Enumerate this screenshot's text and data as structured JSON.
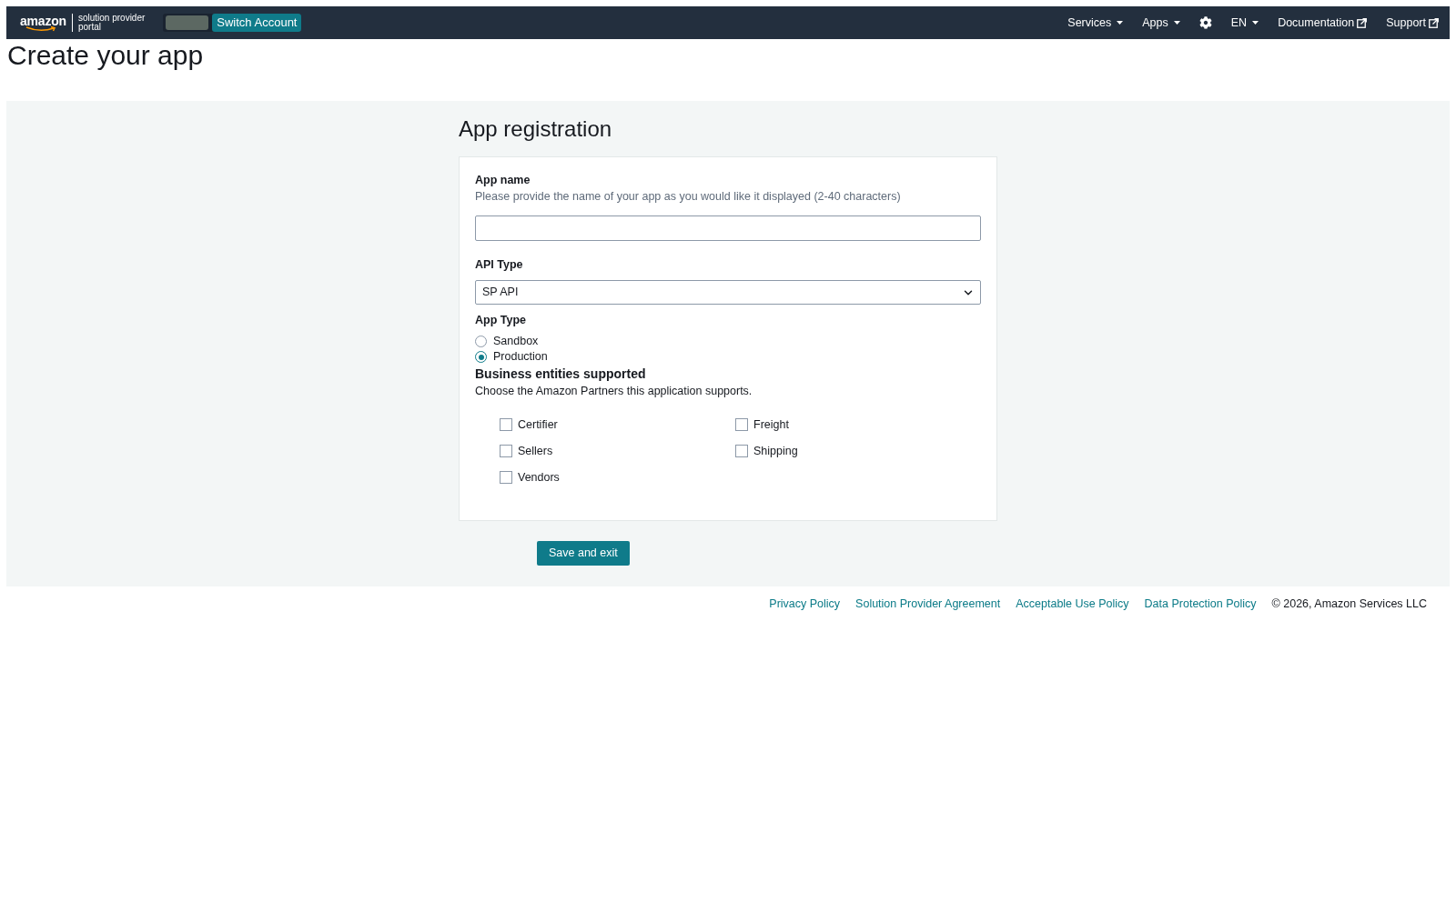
{
  "header": {
    "logo": {
      "wordmark": "amazon",
      "subtitle_lines": [
        "solution provider",
        "portal"
      ]
    },
    "switch_account": {
      "label": "Switch Account"
    },
    "nav": [
      {
        "kind": "menu",
        "label": "Services"
      },
      {
        "kind": "menu",
        "label": "Apps"
      },
      {
        "kind": "settings"
      },
      {
        "kind": "menu",
        "label": "EN"
      },
      {
        "kind": "external",
        "label": "Documentation"
      },
      {
        "kind": "external",
        "label": "Support"
      }
    ]
  },
  "page_title": "Create your app",
  "form": {
    "heading": "App registration",
    "app_name": {
      "label": "App name",
      "description": "Please provide the name of your app as you would like it displayed (2-40 characters)"
    },
    "api_type": {
      "label": "API Type",
      "value": "SP API"
    },
    "app_type": {
      "label": "App Type",
      "options": [
        {
          "label": "Sandbox",
          "selected": false
        },
        {
          "label": "Production",
          "selected": true
        }
      ]
    },
    "business_entities": {
      "heading": "Business entities supported",
      "description": "Choose the Amazon Partners this application supports.",
      "options": [
        {
          "label": "Certifier",
          "checked": false
        },
        {
          "label": "Sellers",
          "checked": false
        },
        {
          "label": "Vendors",
          "checked": false
        },
        {
          "label": "Freight",
          "checked": false
        },
        {
          "label": "Shipping",
          "checked": false
        }
      ]
    },
    "save_button": "Save and exit"
  },
  "footer": {
    "links": [
      "Privacy Policy",
      "Solution Provider Agreement",
      "Acceptable Use Policy",
      "Data Protection Policy"
    ],
    "copyright": "© 2026, Amazon Services LLC"
  }
}
